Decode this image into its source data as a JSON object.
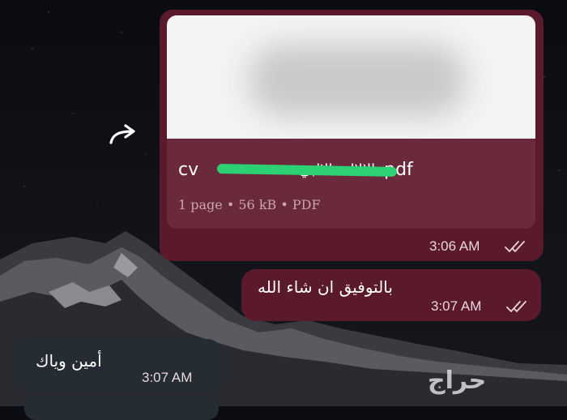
{
  "chat": {
    "file_message": {
      "file_name_prefix": "cv",
      "file_name_hidden": "ــالالالــــالالبي",
      "file_name_suffix": "pdf",
      "meta": "1 page • 56 kB • PDF",
      "time": "3:06 AM",
      "status": "double-check-icon"
    },
    "text_message_out": {
      "text": "بالتوفيق ان شاء الله",
      "time": "3:07 AM",
      "status": "double-check-icon"
    },
    "text_message_in": {
      "text": "أمين وياك",
      "time": "3:07 AM"
    }
  },
  "watermark": "حراج",
  "icons": {
    "forward": "forward-arrow-icon"
  },
  "colors": {
    "outgoing_bubble": "#5a1a2c",
    "incoming_bubble": "#262c33",
    "redaction": "#2bd173"
  }
}
